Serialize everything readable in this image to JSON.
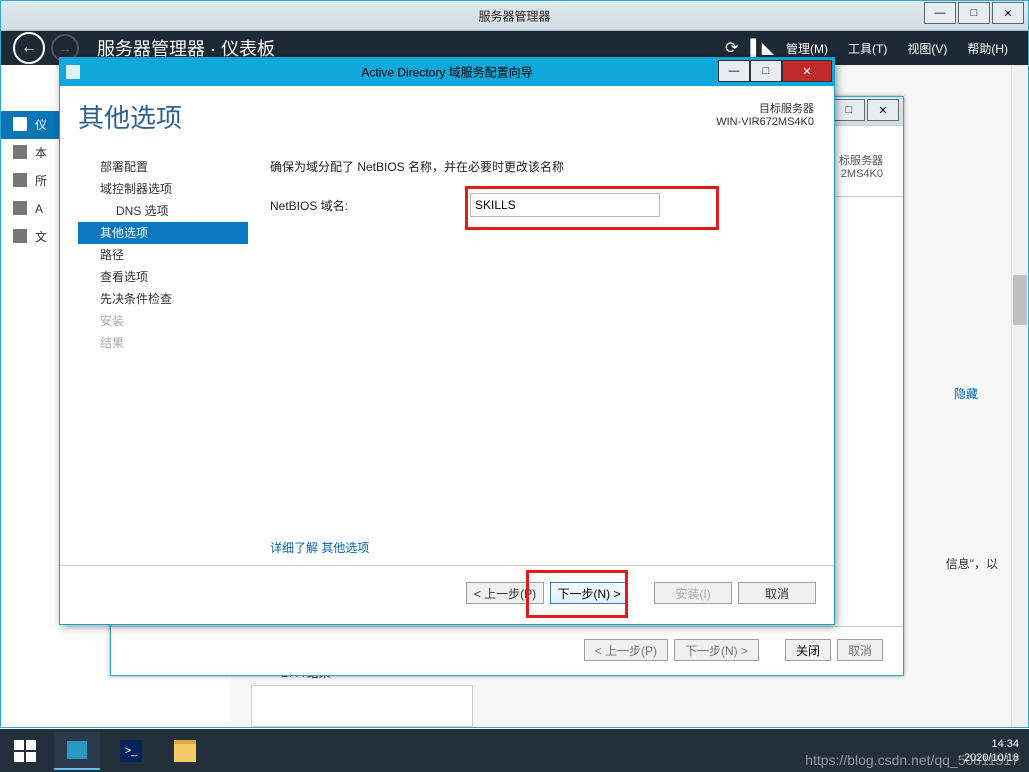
{
  "outer": {
    "title": "服务器管理器",
    "back_arrow": "←",
    "fwd_arrow": "→",
    "heading": "服务器管理器 · 仪表板",
    "menu": {
      "manage": "管理(M)",
      "tools": "工具(T)",
      "view": "视图(V)",
      "help": "帮助(H)"
    },
    "sidebar": {
      "dashboard": "仪",
      "local": "本",
      "all": "所",
      "adds": "A",
      "files": "文"
    },
    "main": {
      "hide": "隐藏",
      "info_tail": "信息\"，以",
      "bpa": "BPA 结果"
    }
  },
  "inner_wizard": {
    "target_label": "标服务器",
    "target_server": "2MS4K0",
    "buttons": {
      "prev": "< 上一步(P)",
      "next": "下一步(N) >",
      "close": "关闭",
      "cancel": "取消"
    }
  },
  "ad": {
    "title": "Active Directory 域服务配置向导",
    "page_title": "其他选项",
    "target_label": "目标服务器",
    "target_server": "WIN-VIR672MS4K0",
    "nav": {
      "deploy": "部署配置",
      "dc_options": "域控制器选项",
      "dns_options": "DNS 选项",
      "other_options": "其他选项",
      "path": "路径",
      "review": "查看选项",
      "prereq": "先决条件检查",
      "install": "安装",
      "result": "结果"
    },
    "instruction": "确保为域分配了 NetBIOS 名称，并在必要时更改该名称",
    "netbios_label": "NetBIOS 域名:",
    "netbios_value": "SKILLS",
    "more_link": "详细了解 其他选项",
    "buttons": {
      "prev": "< 上一步(P)",
      "next": "下一步(N) >",
      "install": "安装(I)",
      "cancel": "取消"
    },
    "controls": {
      "minimize": "—",
      "maximize": "□",
      "close": "✕"
    }
  },
  "taskbar": {
    "ps_label": ">_",
    "time": "14:34",
    "date": "2020/10/18",
    "watermark": "https://blog.csdn.net/qq_50811517"
  }
}
